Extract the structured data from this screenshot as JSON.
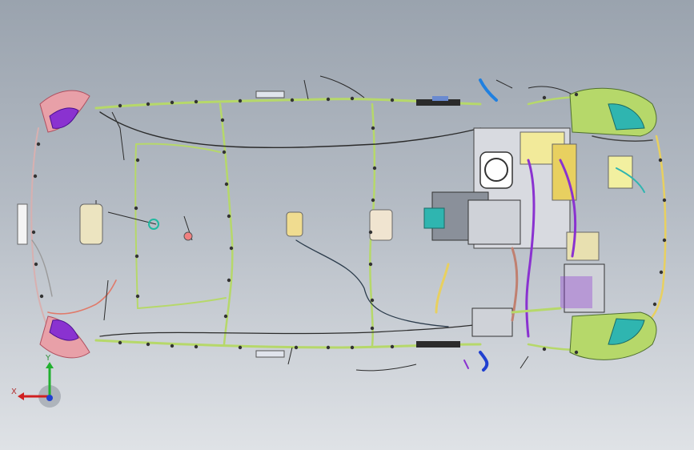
{
  "viewport": {
    "background_top": "#9aa3ae",
    "background_bottom": "#dfe2e6"
  },
  "model": {
    "harness_color": "#b6d86a",
    "wire_dark_color": "#2b2b2b",
    "connector_color": "#333333",
    "engine_bay_color": "#6a6f78",
    "purple_color": "#8a32d0",
    "pink_color": "#e8a0a8",
    "teal_color": "#2fb5b0",
    "yellow_color": "#e8e070",
    "cream_color": "#efe4b0"
  },
  "triad": {
    "x_label": "X",
    "y_label": "Y",
    "x_color": "#d02020",
    "y_color": "#22b030",
    "z_color": "#2040d0"
  }
}
